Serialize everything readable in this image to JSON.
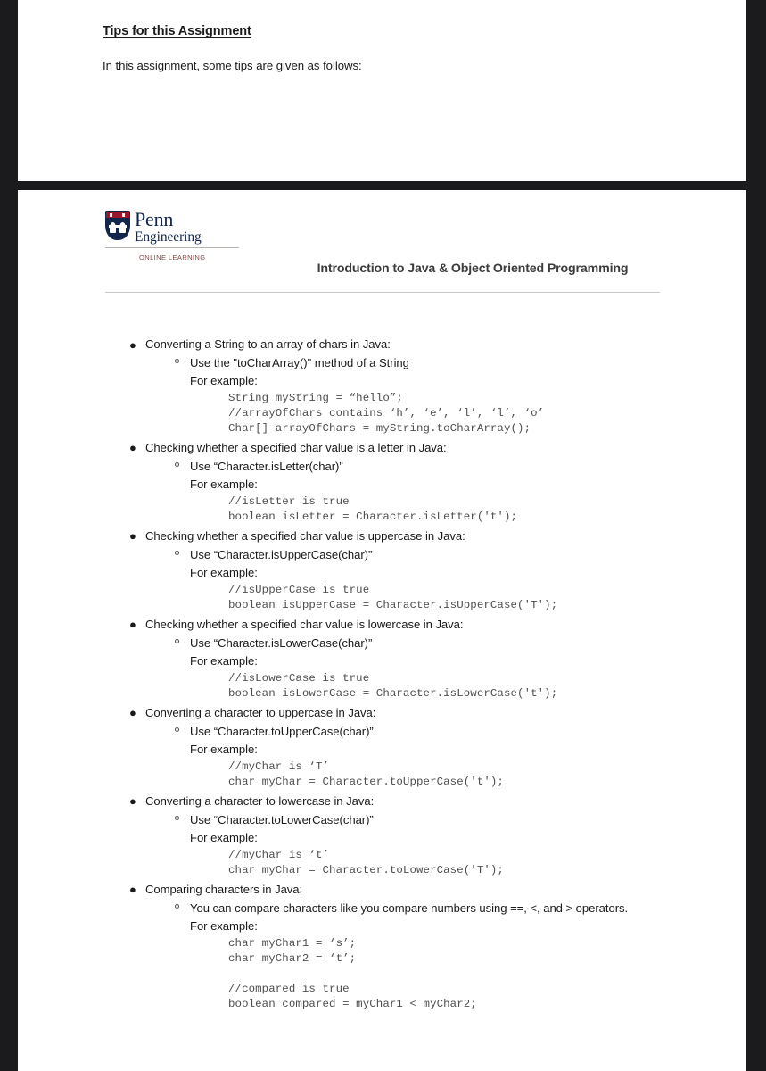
{
  "theme": {
    "page_background": "#ffffff",
    "app_background": "#1b1b1d",
    "text_color": "#1a1a1a",
    "code_color": "#4e4e4e",
    "penn_navy": "#12264b",
    "penn_red": "#99192c",
    "rule_color": "#c9c9c9"
  },
  "tips_page": {
    "heading": "Tips for this Assignment",
    "body": "In this assignment, some tips are given as follows:"
  },
  "document_page": {
    "logo": {
      "wordmark_line1": "Penn",
      "wordmark_line2": "Engineering",
      "tagline": "ONLINE LEARNING"
    },
    "course_title": "Introduction to Java & Object Oriented Programming",
    "bullet_glyph": "●",
    "for_example_label": "For example:",
    "topics": [
      {
        "title": "Converting a String to an array of chars in Java:",
        "method": "Use the \"toCharArray()\" method of a String",
        "code": "String myString = “hello”;\n//arrayOfChars contains ‘h’, ‘e’, ‘l’, ‘l’, ‘o’\nChar[] arrayOfChars = myString.toCharArray();"
      },
      {
        "title": "Checking whether a specified char value is a letter in Java:",
        "method": "Use “Character.isLetter(char)”",
        "code": "//isLetter is true\nboolean isLetter = Character.isLetter('t');"
      },
      {
        "title": "Checking whether a specified char value is uppercase in Java:",
        "method": "Use “Character.isUpperCase(char)”",
        "code": "//isUpperCase is true\nboolean isUpperCase = Character.isUpperCase('T');"
      },
      {
        "title": "Checking whether a specified char value is lowercase in Java:",
        "method": "Use “Character.isLowerCase(char)”",
        "code": "//isLowerCase is true\nboolean isLowerCase = Character.isLowerCase('t');"
      },
      {
        "title": "Converting a character to uppercase in Java:",
        "method": "Use “Character.toUpperCase(char)”",
        "code": "//myChar is ‘T’\nchar myChar = Character.toUpperCase('t');"
      },
      {
        "title": "Converting a character to lowercase in Java:",
        "method": "Use “Character.toLowerCase(char)”",
        "code": "//myChar is ‘t’\nchar myChar = Character.toLowerCase('T');"
      },
      {
        "title": "Comparing characters in Java:",
        "method": "You can compare characters like you compare numbers using ==, <, and > operators.",
        "code": "char myChar1 = ‘s’;\nchar myChar2 = ‘t’;\n\n//compared is true\nboolean compared = myChar1 < myChar2;"
      }
    ]
  }
}
